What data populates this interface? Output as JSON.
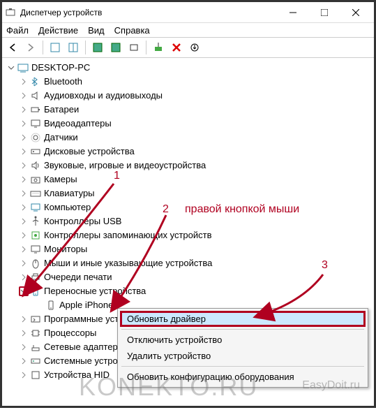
{
  "window": {
    "title": "Диспетчер устройств"
  },
  "menu": {
    "file": "Файл",
    "action": "Действие",
    "view": "Вид",
    "help": "Справка"
  },
  "tree": {
    "root": "DESKTOP-PC",
    "items": [
      {
        "label": "Bluetooth",
        "icon": "bluetooth"
      },
      {
        "label": "Аудиовходы и аудиовыходы",
        "icon": "audio"
      },
      {
        "label": "Батареи",
        "icon": "battery"
      },
      {
        "label": "Видеоадаптеры",
        "icon": "display"
      },
      {
        "label": "Датчики",
        "icon": "sensor"
      },
      {
        "label": "Дисковые устройства",
        "icon": "disk"
      },
      {
        "label": "Звуковые, игровые и видеоустройства",
        "icon": "sound"
      },
      {
        "label": "Камеры",
        "icon": "camera"
      },
      {
        "label": "Клавиатуры",
        "icon": "keyboard"
      },
      {
        "label": "Компьютер",
        "icon": "computer"
      },
      {
        "label": "Контроллеры USB",
        "icon": "usb"
      },
      {
        "label": "Контроллеры запоминающих устройств",
        "icon": "storage"
      },
      {
        "label": "Мониторы",
        "icon": "monitor"
      },
      {
        "label": "Мыши и иные указывающие устройства",
        "icon": "mouse"
      },
      {
        "label": "Очереди печати",
        "icon": "printer"
      },
      {
        "label": "Переносные устройства",
        "icon": "portable",
        "expanded": true,
        "highlight": true
      },
      {
        "label": "Apple iPhone",
        "icon": "phone",
        "child": true
      },
      {
        "label": "Программные устройства",
        "icon": "software"
      },
      {
        "label": "Процессоры",
        "icon": "cpu"
      },
      {
        "label": "Сетевые адаптеры",
        "icon": "network"
      },
      {
        "label": "Системные устройства",
        "icon": "system"
      },
      {
        "label": "Устройства HID",
        "icon": "hid"
      }
    ]
  },
  "context_menu": {
    "update_driver": "Обновить драйвер",
    "disable": "Отключить устройство",
    "uninstall": "Удалить устройство",
    "scan": "Обновить конфигурацию оборудования"
  },
  "annotations": {
    "num1": "1",
    "num2": "2",
    "num3": "3",
    "right_click": "правой кнопкой мыши"
  },
  "watermark": "KONEKTO.RU",
  "watermark2": "EasyDoit.ru"
}
